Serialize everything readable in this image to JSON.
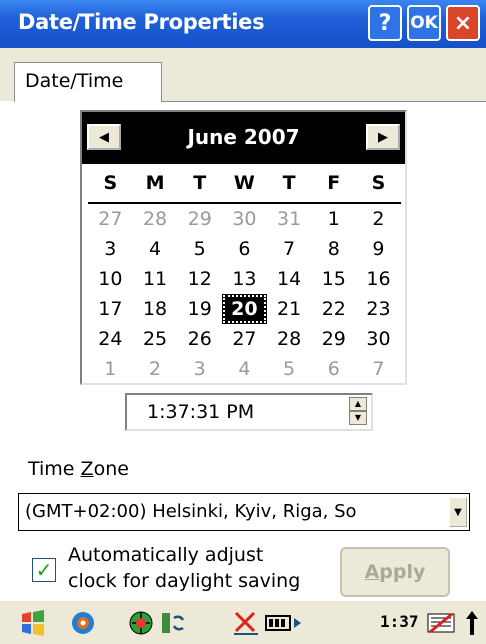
{
  "window": {
    "title": "Date/Time Properties",
    "help_label": "?",
    "ok_label": "OK",
    "close_label": "×"
  },
  "tabs": [
    {
      "label": "Date/Time",
      "selected": true
    }
  ],
  "calendar": {
    "month_label": "June 2007",
    "prev_label": "◀",
    "next_label": "▶",
    "days_of_week": [
      "S",
      "M",
      "T",
      "W",
      "T",
      "F",
      "S"
    ],
    "weeks": [
      [
        {
          "d": "27",
          "dim": true
        },
        {
          "d": "28",
          "dim": true
        },
        {
          "d": "29",
          "dim": true
        },
        {
          "d": "30",
          "dim": true
        },
        {
          "d": "31",
          "dim": true
        },
        {
          "d": "1"
        },
        {
          "d": "2"
        }
      ],
      [
        {
          "d": "3"
        },
        {
          "d": "4"
        },
        {
          "d": "5"
        },
        {
          "d": "6"
        },
        {
          "d": "7"
        },
        {
          "d": "8"
        },
        {
          "d": "9"
        }
      ],
      [
        {
          "d": "10"
        },
        {
          "d": "11"
        },
        {
          "d": "12"
        },
        {
          "d": "13"
        },
        {
          "d": "14"
        },
        {
          "d": "15"
        },
        {
          "d": "16"
        }
      ],
      [
        {
          "d": "17"
        },
        {
          "d": "18"
        },
        {
          "d": "19"
        },
        {
          "d": "20",
          "selected": true
        },
        {
          "d": "21"
        },
        {
          "d": "22"
        },
        {
          "d": "23"
        }
      ],
      [
        {
          "d": "24"
        },
        {
          "d": "25"
        },
        {
          "d": "26"
        },
        {
          "d": "27"
        },
        {
          "d": "28"
        },
        {
          "d": "29"
        },
        {
          "d": "30"
        }
      ],
      [
        {
          "d": "1",
          "dim": true
        },
        {
          "d": "2",
          "dim": true
        },
        {
          "d": "3",
          "dim": true
        },
        {
          "d": "4",
          "dim": true
        },
        {
          "d": "5",
          "dim": true
        },
        {
          "d": "6",
          "dim": true
        },
        {
          "d": "7",
          "dim": true
        }
      ]
    ]
  },
  "time": {
    "value": "1:37:31 PM"
  },
  "timezone": {
    "label_before": "Time ",
    "label_accel": "Z",
    "label_after": "one",
    "value": "(GMT+02:00) Helsinki, Kyiv, Riga, So"
  },
  "dst": {
    "checked": true,
    "label_line1": "Automatically adjust",
    "label_line2": "clock for daylight saving"
  },
  "apply": {
    "accel": "A",
    "rest": "pply"
  },
  "taskbar": {
    "clock": "1:37 PM",
    "icons": [
      "start-icon",
      "sync-icon",
      "network-icon",
      "activesync-icon",
      "signal-off-icon",
      "battery-icon",
      "keyboard-icon",
      "arrow-up-icon"
    ]
  },
  "colors": {
    "titlebar": "#1f5fd8",
    "close_button": "#d9462a",
    "panel_bg": "#ece9d8"
  }
}
